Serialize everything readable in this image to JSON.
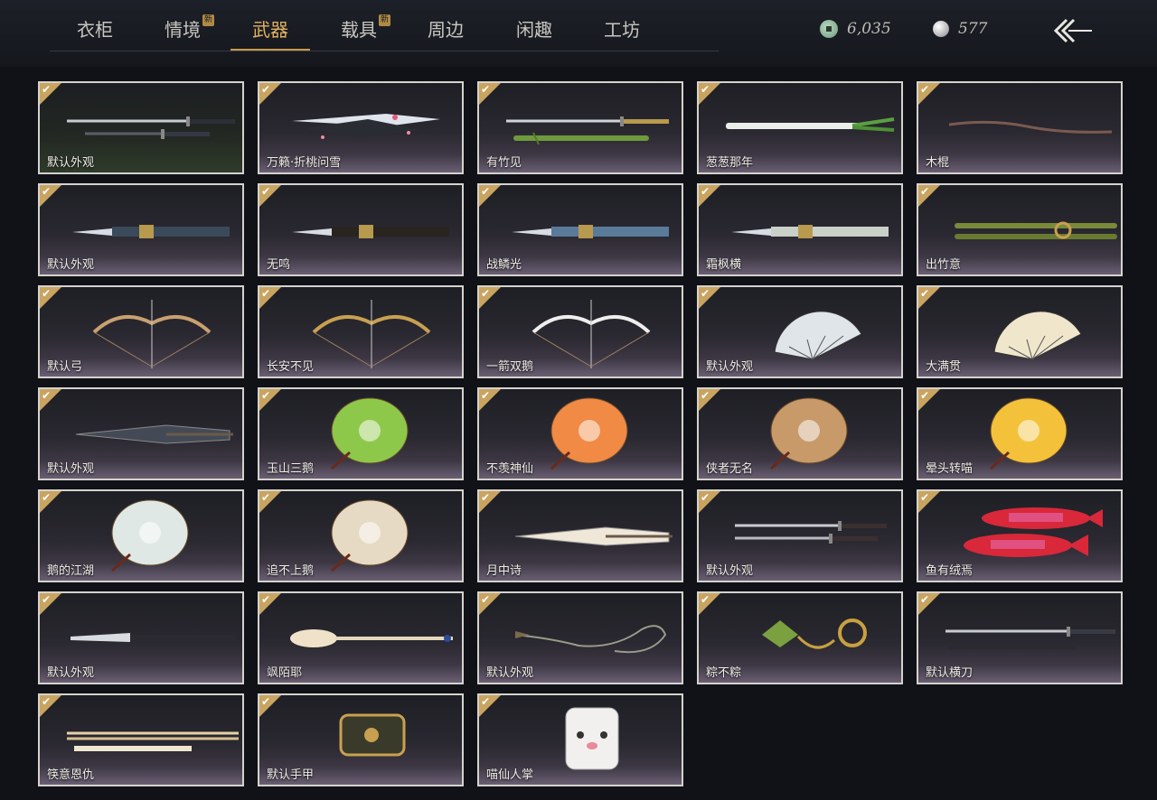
{
  "tabs": [
    {
      "label": "衣柜",
      "new": false
    },
    {
      "label": "情境",
      "new": true
    },
    {
      "label": "武器",
      "new": false,
      "active": true
    },
    {
      "label": "载具",
      "new": true
    },
    {
      "label": "周边",
      "new": false
    },
    {
      "label": "闲趣",
      "new": false
    },
    {
      "label": "工坊",
      "new": false
    }
  ],
  "new_badge": "新",
  "currency": {
    "jade": "6,035",
    "pearl": "577"
  },
  "items": [
    {
      "label": "默认外观",
      "art": "sword"
    },
    {
      "label": "万籁·折桃问雪",
      "art": "sword2"
    },
    {
      "label": "有竹见",
      "art": "bamboo"
    },
    {
      "label": "葱葱那年",
      "art": "scallion"
    },
    {
      "label": "木棍",
      "art": "stick"
    },
    {
      "label": "默认外观",
      "art": "spear"
    },
    {
      "label": "无鸣",
      "art": "spear2"
    },
    {
      "label": "战鳞光",
      "art": "spear3"
    },
    {
      "label": "霜枫横",
      "art": "spear4"
    },
    {
      "label": "出竹意",
      "art": "bamboo2"
    },
    {
      "label": "默认弓",
      "art": "bow"
    },
    {
      "label": "长安不见",
      "art": "bow2"
    },
    {
      "label": "一箭双鹅",
      "art": "bow3"
    },
    {
      "label": "默认外观",
      "art": "fan"
    },
    {
      "label": "大满贯",
      "art": "fan2"
    },
    {
      "label": "默认外观",
      "art": "umbrella-closed"
    },
    {
      "label": "玉山三鹅",
      "art": "umbrella-green"
    },
    {
      "label": "不羡神仙",
      "art": "umbrella-orange"
    },
    {
      "label": "侠者无名",
      "art": "umbrella-brown"
    },
    {
      "label": "晕头转喵",
      "art": "umbrella-yellow"
    },
    {
      "label": "鹅的江湖",
      "art": "umbrella-white"
    },
    {
      "label": "追不上鹅",
      "art": "umbrella-cream"
    },
    {
      "label": "月中诗",
      "art": "umbrella-closed2"
    },
    {
      "label": "默认外观",
      "art": "twinblades"
    },
    {
      "label": "鱼有绒焉",
      "art": "fish"
    },
    {
      "label": "默认外观",
      "art": "glaive"
    },
    {
      "label": "飒陌耶",
      "art": "spoon"
    },
    {
      "label": "默认外观",
      "art": "rope"
    },
    {
      "label": "粽不粽",
      "art": "zongzi"
    },
    {
      "label": "默认横刀",
      "art": "hengdao"
    },
    {
      "label": "筷意恩仇",
      "art": "chopsticks"
    },
    {
      "label": "默认手甲",
      "art": "gauntlet"
    },
    {
      "label": "喵仙人掌",
      "art": "catpaw"
    }
  ]
}
